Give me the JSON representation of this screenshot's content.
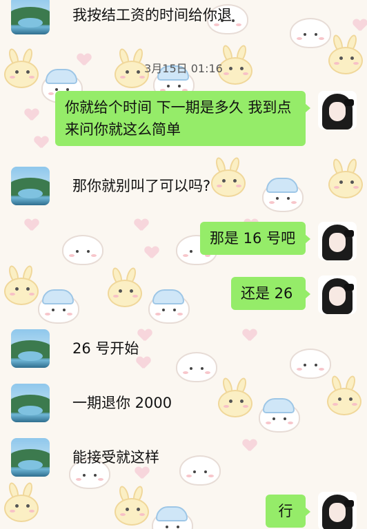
{
  "timestamp": "3月15日 01:16",
  "messages": [
    {
      "side": "in",
      "avatar": "landscape-avatar",
      "text": "我按结工资的时间给你退"
    },
    {
      "side": "out",
      "avatar": "girl-avatar",
      "text": "你就给个时间 下一期是多久 我到点来问你就这么简单"
    },
    {
      "side": "in",
      "avatar": "landscape-avatar",
      "text": "那你就别叫了可以吗?"
    },
    {
      "side": "out",
      "avatar": "girl-avatar",
      "text": "那是 16 号吧"
    },
    {
      "side": "out",
      "avatar": "girl-avatar",
      "text": "还是 26"
    },
    {
      "side": "in",
      "avatar": "landscape-avatar",
      "text": "26 号开始"
    },
    {
      "side": "in",
      "avatar": "landscape-avatar",
      "text": "一期退你 2000"
    },
    {
      "side": "in",
      "avatar": "landscape-avatar",
      "text": "能接受就这样"
    },
    {
      "side": "out",
      "avatar": "girl-avatar",
      "text": "行"
    }
  ],
  "colors": {
    "outgoing_bubble": "#95ec69",
    "background": "#fbf7f1"
  }
}
